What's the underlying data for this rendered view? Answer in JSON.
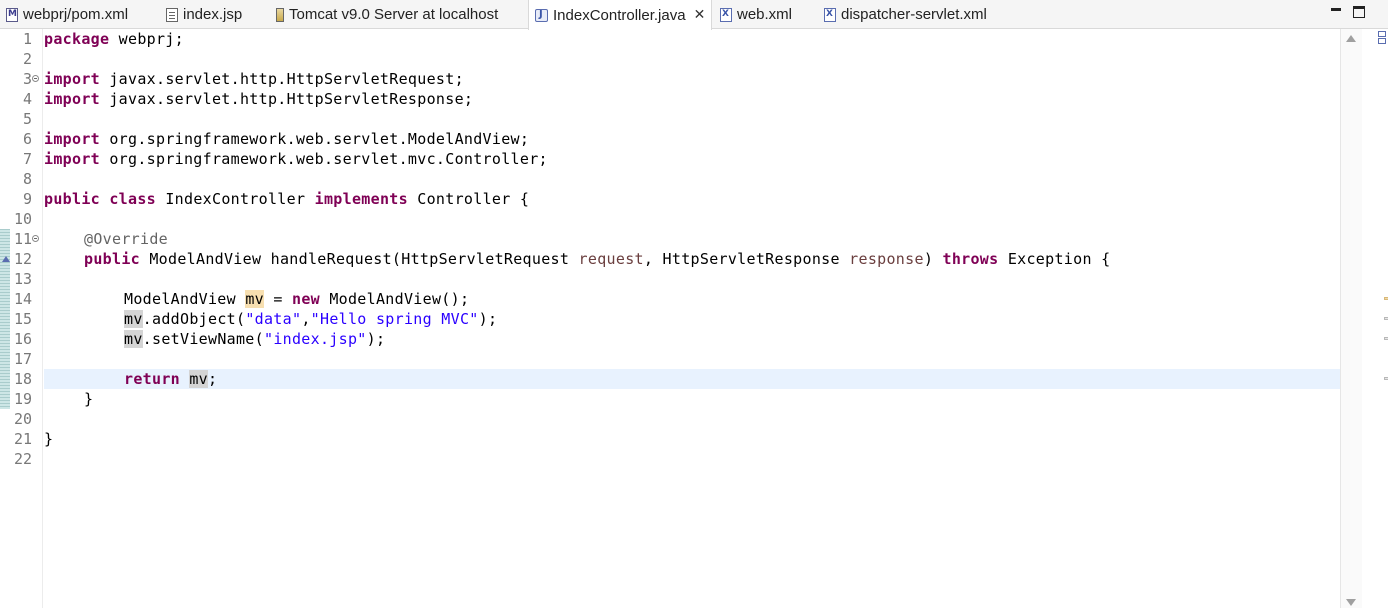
{
  "tabs": [
    {
      "label": "webprj/pom.xml",
      "icon": "maven-pom-icon"
    },
    {
      "label": "index.jsp",
      "icon": "jsp-file-icon"
    },
    {
      "label": "Tomcat v9.0 Server at localhost",
      "icon": "server-icon"
    },
    {
      "label": "IndexController.java",
      "icon": "java-file-icon",
      "active": true,
      "close": "✕"
    },
    {
      "label": "web.xml",
      "icon": "xml-file-icon"
    },
    {
      "label": "dispatcher-servlet.xml",
      "icon": "xml-file-icon"
    }
  ],
  "editor": {
    "current_line": 18,
    "lines": [
      {
        "n": "1"
      },
      {
        "n": "2"
      },
      {
        "n": "3"
      },
      {
        "n": "4"
      },
      {
        "n": "5"
      },
      {
        "n": "6"
      },
      {
        "n": "7"
      },
      {
        "n": "8"
      },
      {
        "n": "9"
      },
      {
        "n": "10"
      },
      {
        "n": "11"
      },
      {
        "n": "12"
      },
      {
        "n": "13"
      },
      {
        "n": "14"
      },
      {
        "n": "15"
      },
      {
        "n": "16"
      },
      {
        "n": "17"
      },
      {
        "n": "18"
      },
      {
        "n": "19"
      },
      {
        "n": "20"
      },
      {
        "n": "21"
      },
      {
        "n": "22"
      }
    ],
    "code": {
      "l1": {
        "kw": "package",
        "rest": " webprj;"
      },
      "l3": {
        "kw": "import",
        "rest": " javax.servlet.http.HttpServletRequest;"
      },
      "l4": {
        "kw": "import",
        "rest": " javax.servlet.http.HttpServletResponse;"
      },
      "l6": {
        "kw": "import",
        "rest": " org.springframework.web.servlet.ModelAndView;"
      },
      "l7": {
        "kw": "import",
        "rest": " org.springframework.web.servlet.mvc.Controller;"
      },
      "l9": {
        "kw1": "public",
        "kw2": "class",
        "name": " IndexController ",
        "kw3": "implements",
        "rest": " Controller {"
      },
      "l11": {
        "ann": "@Override"
      },
      "l12": {
        "kw1": "public",
        "t1": " ModelAndView handleRequest(HttpServletRequest ",
        "p1": "request",
        "t2": ", HttpServletResponse ",
        "p2": "response",
        "t3": ") ",
        "kw2": "throws",
        "t4": " Exception {"
      },
      "l14": {
        "t1": "ModelAndView ",
        "var": "mv",
        "t2": " = ",
        "kw": "new",
        "t3": " ModelAndView();"
      },
      "l15": {
        "var": "mv",
        "t1": ".addObject(",
        "s1": "\"data\"",
        "t2": ",",
        "s2": "\"Hello spring MVC\"",
        "t3": ");"
      },
      "l16": {
        "var": "mv",
        "t1": ".setViewName(",
        "s1": "\"index.jsp\"",
        "t2": ");"
      },
      "l18": {
        "kw": "return",
        "t1": " ",
        "var": "mv",
        "t2": ";"
      },
      "l19": {
        "t1": "}"
      },
      "l21": {
        "t1": "}"
      }
    }
  },
  "colors": {
    "keyword": "#7f0055",
    "string": "#2a00ff",
    "annotation": "#646464",
    "parameter": "#6a3e3e",
    "current_line": "#e8f2fe"
  }
}
